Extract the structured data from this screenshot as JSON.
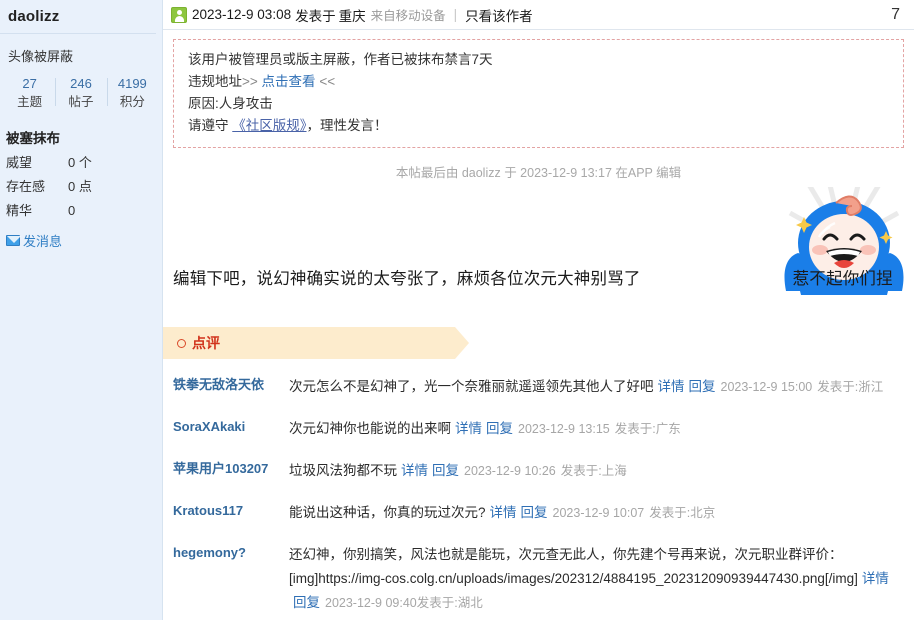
{
  "sidebar": {
    "username": "daolizz",
    "avatar_note": "头像被屏蔽",
    "stats": [
      {
        "value": "27",
        "label": "主题"
      },
      {
        "value": "246",
        "label": "帖子"
      },
      {
        "value": "4199",
        "label": "积分"
      }
    ],
    "group_title": "被塞抹布",
    "rows": [
      {
        "key": "威望",
        "value": "0 个"
      },
      {
        "key": "存在感",
        "value": "0 点"
      },
      {
        "key": "精华",
        "value": "0"
      }
    ],
    "message_label": "发消息",
    "message_icon": "envelope-icon"
  },
  "post": {
    "avatar_icon": "user-avatar-icon",
    "date": "2023-12-9 03:08",
    "publish_word": "发表于",
    "location": "重庆",
    "from_device": "来自移动设备",
    "only_author": "只看该作者",
    "floor": "7",
    "warning": {
      "line1": "该用户被管理员或版主屏蔽，作者已被抹布禁言7天",
      "line2_prefix": "违规地址",
      "line2_arrows_left": ">>",
      "line2_link": "点击查看",
      "line2_arrows_right": "<<",
      "line3": "原因:人身攻击",
      "line4_prefix": "请遵守",
      "line4_link": "《社区版规》",
      "line4_suffix": "，理性发言！"
    },
    "edit_note": "本帖最后由 daolizz 于 2023-12-9 13:17 在APP 编辑",
    "content_before": "编辑下吧，说幻神确实说的太夸张了，麻烦各位次元大神别骂了",
    "content_after": "惹不起你们捏",
    "sticker_icon": "blue-character-sticker"
  },
  "comments_section": {
    "banner_label": "点评",
    "banner_icon": "circle-icon",
    "detail_label": "详情",
    "reply_label": "回复",
    "items": [
      {
        "user": "铁拳无敌洛天依",
        "text": "次元怎么不是幻神了，光一个奈雅丽就遥遥领先其他人了好吧",
        "time": "2023-12-9 15:00",
        "location": "发表于:浙江"
      },
      {
        "user": "SoraXAkaki",
        "text": "次元幻神你也能说的出来啊",
        "time": "2023-12-9 13:15",
        "location": "发表于:广东"
      },
      {
        "user": "苹果用户103207",
        "text": "垃圾风法狗都不玩",
        "time": "2023-12-9 10:26",
        "location": "发表于:上海"
      },
      {
        "user": "Kratous117",
        "text": "能说出这种话，你真的玩过次元?",
        "time": "2023-12-9 10:07",
        "location": "发表于:北京"
      },
      {
        "user": "hegemony?",
        "text": "还幻神，你别搞笑，风法也就是能玩，次元查无此人，你先建个号再来说，次元职业群评价：  [img]https://img-cos.colg.cn/uploads/images/202312/4884195_202312090939447430.png[/img]",
        "time": "2023-12-9 09:40",
        "location": "发表于:湖北"
      }
    ]
  },
  "colors": {
    "sidebar_bg": "#e9f1fb",
    "link_blue": "#2f6fb5",
    "user_blue": "#34699c",
    "banner_bg": "#fdeccd",
    "banner_text": "#d1321b",
    "warn_border": "#e3a3a3",
    "muted": "#a6a6a6"
  }
}
